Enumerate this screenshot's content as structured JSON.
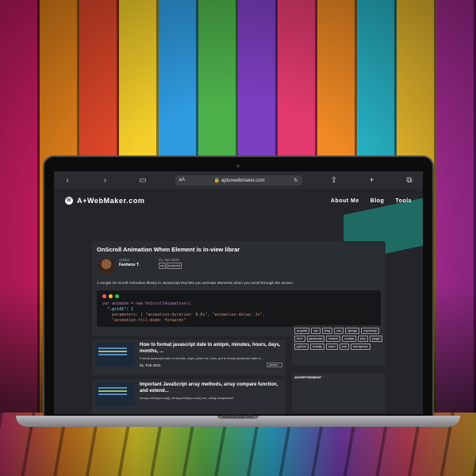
{
  "background": {
    "plank_colors": [
      "#d81f6a",
      "#f28a1c",
      "#e84a2b",
      "#f5d02a",
      "#2f9be0",
      "#4cb04a",
      "#7c3fc0",
      "#e23a6e",
      "#f08a24",
      "#28b6c9",
      "#f1c02e",
      "#b22fa0"
    ]
  },
  "browser": {
    "back_icon": "chevron-left-icon",
    "forward_icon": "chevron-right-icon",
    "reader_label": "aA",
    "url": "apluswebmaker.com",
    "reload_icon": "reload-icon"
  },
  "site": {
    "brand": "A+WebMaker.com",
    "nav": [
      "About Me",
      "Blog",
      "Tools"
    ]
  },
  "article": {
    "title": "OnScroll Animation When Element is in-view librar",
    "author_label": "Author",
    "author_name": "Fashanu T.",
    "date": "21, Apr 2020",
    "tags": [
      "css",
      "javascript"
    ],
    "summary": "A simple On Scroll Animation library in JavaScript that lets you animate elements when you scroll through the screen.",
    "code_lines": [
      "var animate = new OnScrollAnimation({",
      "  \".grid1\": {",
      "    parameters: [ \"animation-duration: 0.8s\", \"animation-delay: 1s\",",
      "    \"animation-fill-mode: forwards\""
    ]
  },
  "posts": [
    {
      "title": "How to format javascript date to am/pm, minutes, hours, days, months, ...",
      "desc": "Format javascript date in months, days, years etc. Also, get to format javascript date in...",
      "date": "01, Feb 2021",
      "tag": "javascr..."
    },
    {
      "title": "Important JavaScript array methods, array compare function, and extend...",
      "desc": "Array.prototype.map(), Array.prototype.sort() etc, using comparison",
      "date": "",
      "tag": ""
    }
  ],
  "tag_cloud": [
    "angular",
    "api",
    "blog",
    "css",
    "django",
    "expressjs",
    "html",
    "javascript",
    "laravel",
    "nodejs",
    "php",
    "plugin",
    "python",
    "reactjs",
    "store",
    "vue",
    "wordpress"
  ],
  "advert_label": "ADVERTISEMENT",
  "laptop_label": "MacBook Air"
}
